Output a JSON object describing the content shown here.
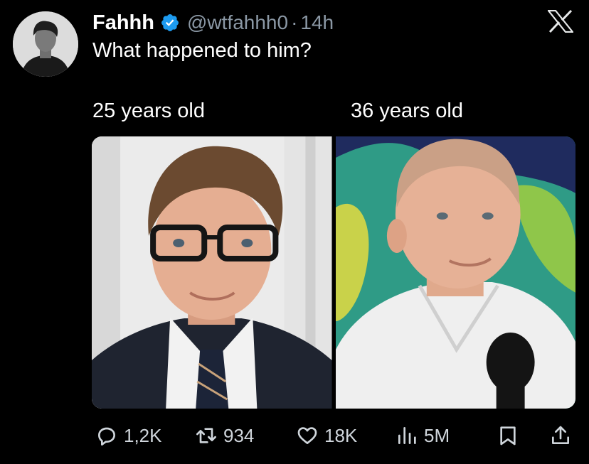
{
  "post": {
    "author_name": "Fahhh",
    "handle": "@wtfahhh0",
    "separator": "·",
    "time": "14h",
    "text": "What happened to him?",
    "verified_color": "#1d9bf0"
  },
  "media": {
    "left_caption": "25 years old",
    "right_caption": "36 years old"
  },
  "actions": {
    "replies": "1,2K",
    "reposts": "934",
    "likes": "18K",
    "views": "5M"
  },
  "icons": [
    "verified-badge-icon",
    "x-logo-icon",
    "reply-icon",
    "repost-icon",
    "like-icon",
    "views-icon",
    "bookmark-icon",
    "share-icon"
  ]
}
